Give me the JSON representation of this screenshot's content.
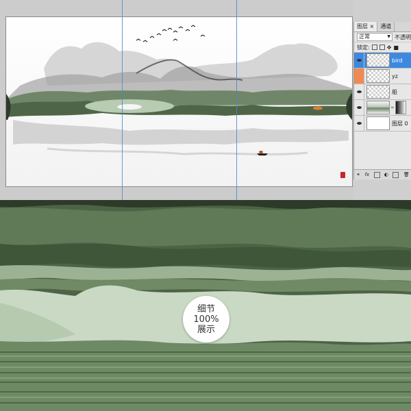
{
  "layers_panel": {
    "tabs": [
      {
        "label": "图层",
        "close": "×"
      },
      {
        "label": "通道"
      }
    ],
    "blend_mode": "正常",
    "opacity_label": "不透明",
    "lock_label": "锁定:",
    "layers": [
      {
        "name": "bird",
        "selected": true
      },
      {
        "name": "yz",
        "selected": false
      },
      {
        "name": "船",
        "selected": false
      },
      {
        "name": "",
        "selected": false
      },
      {
        "name": "图层 0",
        "selected": false
      }
    ],
    "footer_fx": "fx"
  },
  "badge": {
    "line1": "细节",
    "line2": "100%",
    "line3": "展示"
  },
  "colors": {
    "guide": "#4a86c9",
    "selection": "#3d89e0",
    "eye_highlight": "#f08a52",
    "seal": "#c8262b",
    "zoom_green_dark": "#4b6544",
    "zoom_green_light": "#c8d8c4"
  }
}
